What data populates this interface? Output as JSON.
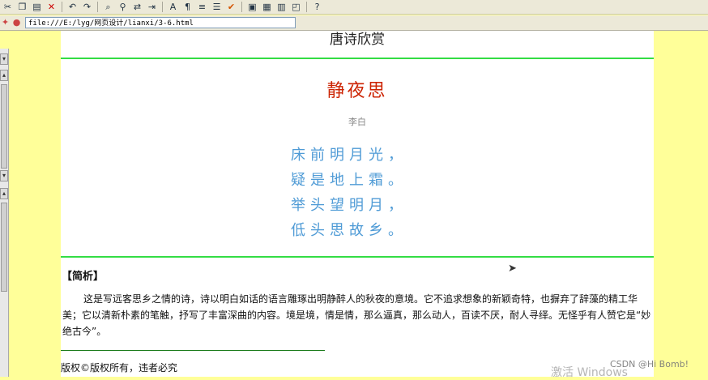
{
  "address_bar": {
    "url": "file:///E:/lyg/网页设计/lianxi/3-6.html"
  },
  "page": {
    "site_title": "唐诗欣赏",
    "poem": {
      "title": "静夜思",
      "author": "李白",
      "lines": [
        "床前明月光，",
        "疑是地上霜。",
        "举头望明月，",
        "低头思故乡。"
      ]
    },
    "analysis": {
      "heading": "【简析】",
      "text": "这是写远客思乡之情的诗，诗以明白如话的语言雕琢出明静醉人的秋夜的意境。它不追求想象的新颖奇特，也摒弃了辞藻的精工华美；它以清新朴素的笔触，抒写了丰富深曲的内容。境是境，情是情，那么逼真，那么动人，百读不厌，耐人寻绎。无怪乎有人赞它是“妙绝古今”。"
    },
    "footer": {
      "copyright": "版权©版权所有，违者必究"
    }
  },
  "overlay": {
    "watermark": "激活 Windows",
    "csdn": "CSDN @Hi Bomb!"
  },
  "colors": {
    "page_bg": "#ffff99",
    "rule": "#33dd44",
    "poem_title": "#cc2200",
    "poem_text": "#4f9bd6"
  },
  "icons": [
    "cut-icon",
    "copy-icon",
    "paste-icon",
    "delete-icon",
    "undo-icon",
    "redo-icon",
    "find-icon",
    "replace-icon",
    "spell-check-icon"
  ]
}
